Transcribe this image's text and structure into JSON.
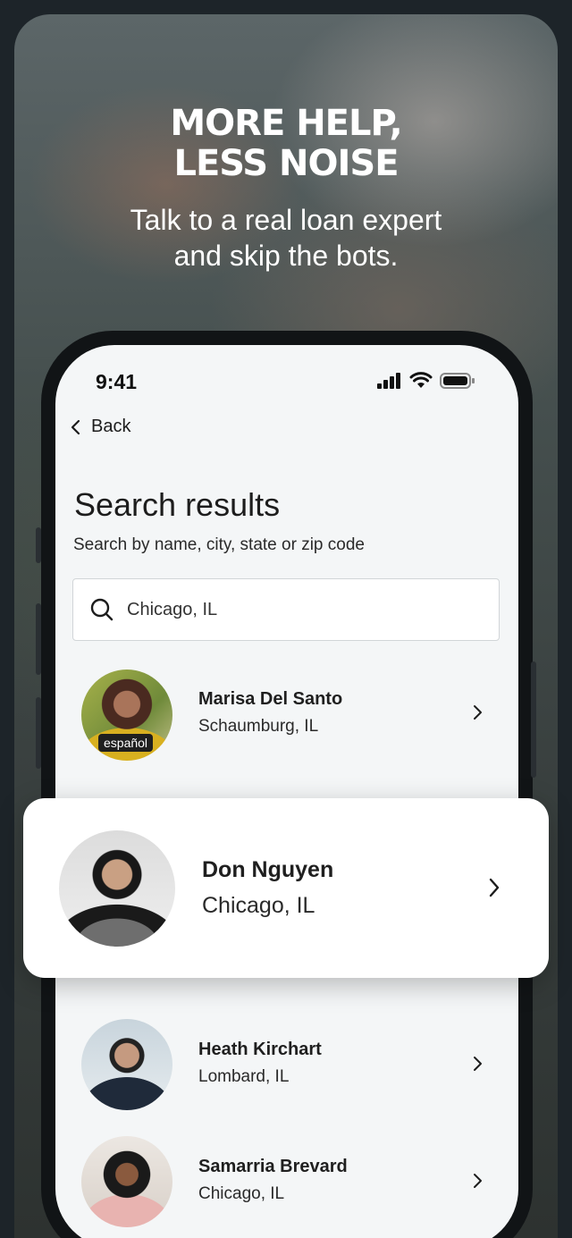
{
  "promo": {
    "headline_line1": "MORE HELP,",
    "headline_line2": "LESS NOISE",
    "subline_line1": "Talk to a real loan expert",
    "subline_line2": "and skip the bots."
  },
  "status_bar": {
    "time": "9:41"
  },
  "nav": {
    "back_label": "Back"
  },
  "page": {
    "title": "Search results",
    "subtitle": "Search by name, city, state or zip code"
  },
  "search": {
    "value": "Chicago, IL"
  },
  "agents": [
    {
      "name": "Marisa Del Santo",
      "city": "Schaumburg, IL",
      "badge": "español"
    },
    {
      "name": "Don Nguyen",
      "city": "Chicago, IL"
    },
    {
      "name": "Heath Kirchart",
      "city": "Lombard, IL"
    },
    {
      "name": "Samarria Brevard",
      "city": "Chicago, IL"
    }
  ],
  "colors": {
    "background": "#1d2429",
    "screen": "#f4f6f7",
    "text": "#1f1f1f",
    "card": "#ffffff"
  }
}
